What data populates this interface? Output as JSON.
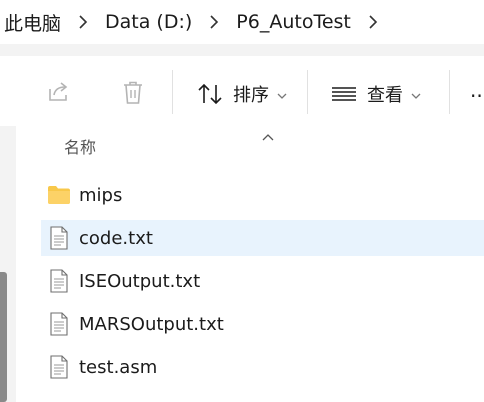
{
  "address_bar": {
    "breadcrumbs": [
      "此电脑",
      "Data (D:)",
      "P6_AutoTest"
    ]
  },
  "toolbar": {
    "sort_label": "排序",
    "view_label": "查看",
    "more_label": "..."
  },
  "file_list": {
    "column_name": "名称",
    "items": [
      {
        "name": "mips",
        "icon": "folder-icon"
      },
      {
        "name": "code.txt",
        "icon": "text-file-icon"
      },
      {
        "name": "ISEOutput.txt",
        "icon": "text-file-icon"
      },
      {
        "name": "MARSOutput.txt",
        "icon": "text-file-icon"
      },
      {
        "name": "test.asm",
        "icon": "text-file-icon"
      }
    ]
  },
  "colors": {
    "selection": "#e8f3fd",
    "folder": "#f8c84a",
    "accent": "#0067c0"
  }
}
